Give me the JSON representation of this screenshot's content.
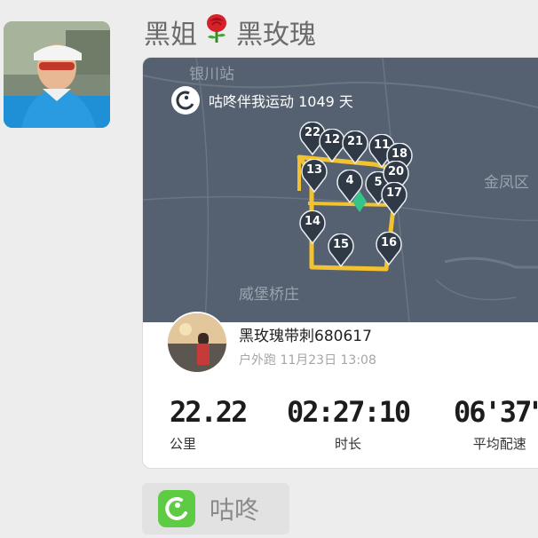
{
  "chat": {
    "sender_name": "黑姐",
    "sender_suffix": "黑玫瑰",
    "sender_emoji": "rose-emoji",
    "avatar_icon": "user-photo"
  },
  "card": {
    "banner_text": "咕咚伴我运动 1049 天",
    "map_labels": [
      "银川站",
      "金凤区",
      "威堡桥庄"
    ],
    "pins": [
      "22",
      "12",
      "21",
      "11",
      "18",
      "13",
      "4",
      "5",
      "20",
      "17",
      "14",
      "15",
      "16",
      "4"
    ],
    "runner": {
      "name": "黑玫瑰带刺680617",
      "meta": "户外跑 11月23日 13:08"
    },
    "stats": [
      {
        "value": "22.22",
        "label": "公里"
      },
      {
        "value": "02:27:10",
        "label": "时长"
      },
      {
        "value": "06'37\"",
        "label": "平均配速"
      }
    ]
  },
  "app": {
    "name": "咕咚",
    "icon": "codoon-logo-icon"
  },
  "colors": {
    "map_bg": "#556170",
    "route": "#f2c230",
    "pin": "#2f3a46",
    "app_green": "#5ecb44"
  }
}
